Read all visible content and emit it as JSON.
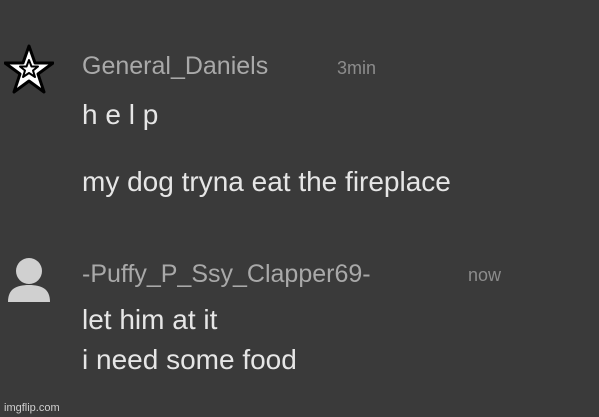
{
  "messages": [
    {
      "avatar_icon": "star-badge-icon",
      "username": "General_Daniels",
      "time": "3min",
      "lines": [
        "h e l p",
        "my dog tryna eat the fireplace"
      ]
    },
    {
      "avatar_icon": "default-user-avatar-icon",
      "username": "-Puffy_P_Ssy_Clapper69-",
      "time": "now",
      "lines": [
        "let him at it",
        "i need some food"
      ]
    }
  ],
  "watermark": "imgflip.com"
}
